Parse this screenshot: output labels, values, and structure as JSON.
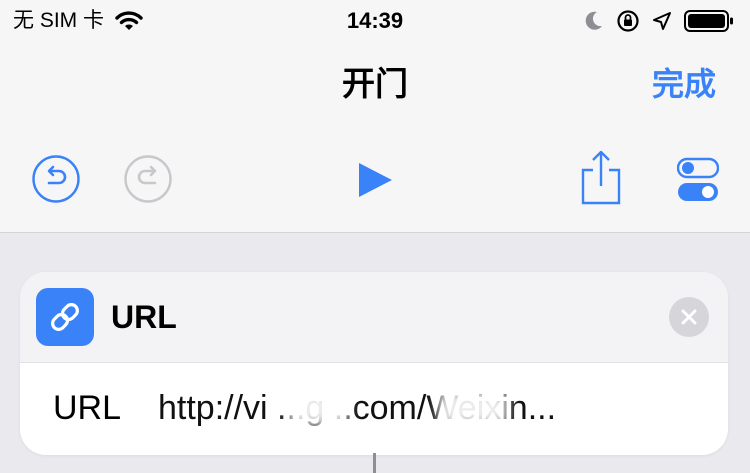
{
  "status_bar": {
    "carrier": "无 SIM 卡",
    "time": "14:39"
  },
  "nav": {
    "title": "开门",
    "done_label": "完成"
  },
  "toolbar": {
    "undo_icon": "undo-icon",
    "redo_icon": "redo-icon",
    "play_icon": "play-icon",
    "share_icon": "share-icon",
    "settings_icon": "toggles-icon"
  },
  "action": {
    "title": "URL",
    "icon": "link-icon",
    "param_label": "URL",
    "param_value": "http://vi  ...g  ..com/Weixin..."
  },
  "colors": {
    "accent": "#3a82f7",
    "background": "#e9e9ee",
    "bar": "#f6f6f7"
  }
}
